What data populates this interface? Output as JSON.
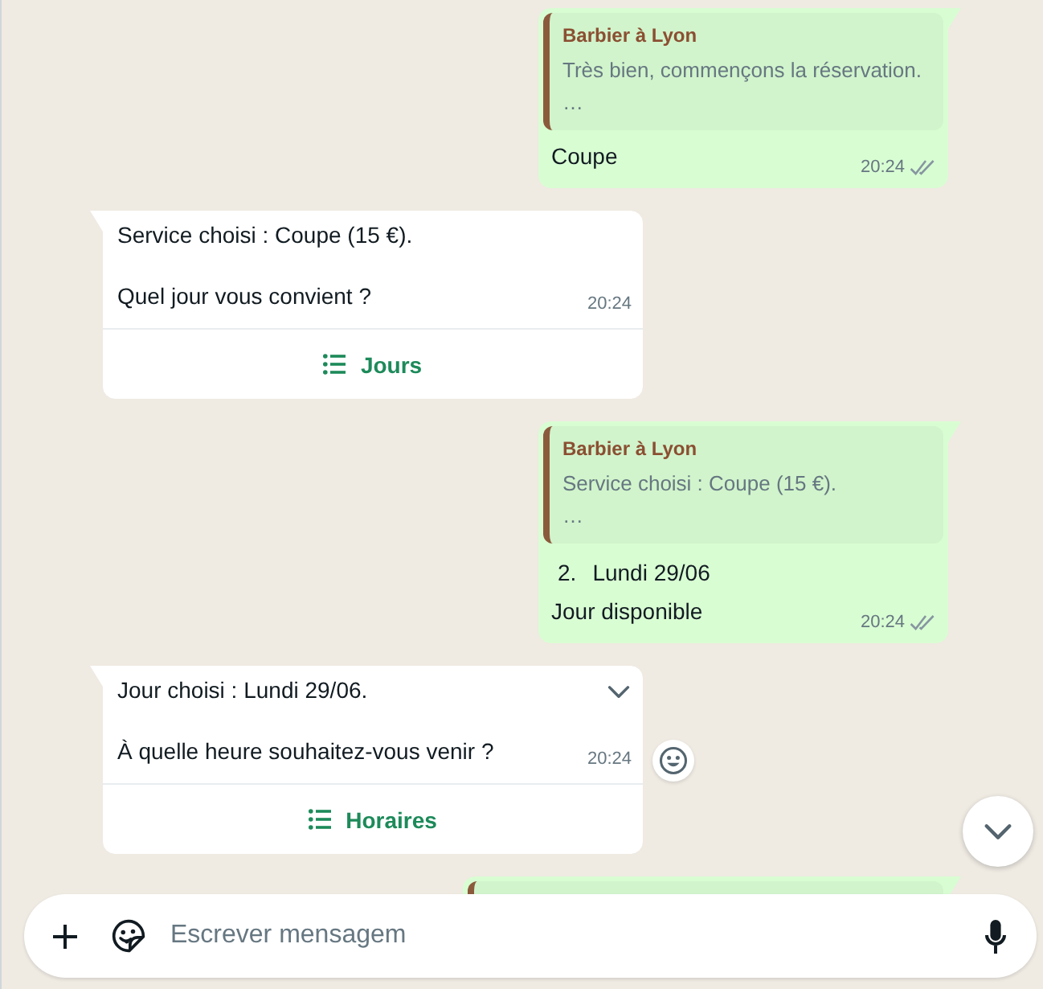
{
  "chat": {
    "messages": [
      {
        "kind": "outgoing",
        "quote": {
          "author": "Barbier à Lyon",
          "lines": [
            "Très bien, commençons la réservation.",
            "…"
          ]
        },
        "body": [
          {
            "kind": "paragraph",
            "text": "Coupe"
          }
        ],
        "time": "20:24",
        "read": false,
        "hovered": false
      },
      {
        "kind": "incoming",
        "body": [
          {
            "kind": "paragraph",
            "text": "Service choisi : Coupe (15 €)."
          },
          {
            "kind": "paragraph",
            "text": "Quel jour vous convient ?"
          }
        ],
        "time": "20:24",
        "action": {
          "label": "Jours"
        },
        "hovered": false
      },
      {
        "kind": "outgoing",
        "quote": {
          "author": "Barbier à Lyon",
          "lines": [
            "Service choisi : Coupe (15 €).",
            "…"
          ]
        },
        "body": [
          {
            "kind": "numbered",
            "marker": "2.",
            "text": "Lundi 29/06"
          },
          {
            "kind": "paragraph",
            "text": "Jour disponible"
          }
        ],
        "time": "20:24",
        "read": false,
        "hovered": false
      },
      {
        "kind": "incoming",
        "body": [
          {
            "kind": "paragraph",
            "text": "Jour choisi : Lundi 29/06."
          },
          {
            "kind": "paragraph",
            "text": "À quelle heure souhaitez-vous venir ?"
          }
        ],
        "time": "20:24",
        "action": {
          "label": "Horaires"
        },
        "hovered": true
      },
      {
        "kind": "outgoing-fragment"
      }
    ],
    "scroll_down_button": true
  },
  "composer": {
    "placeholder": "Escrever mensagem"
  }
}
